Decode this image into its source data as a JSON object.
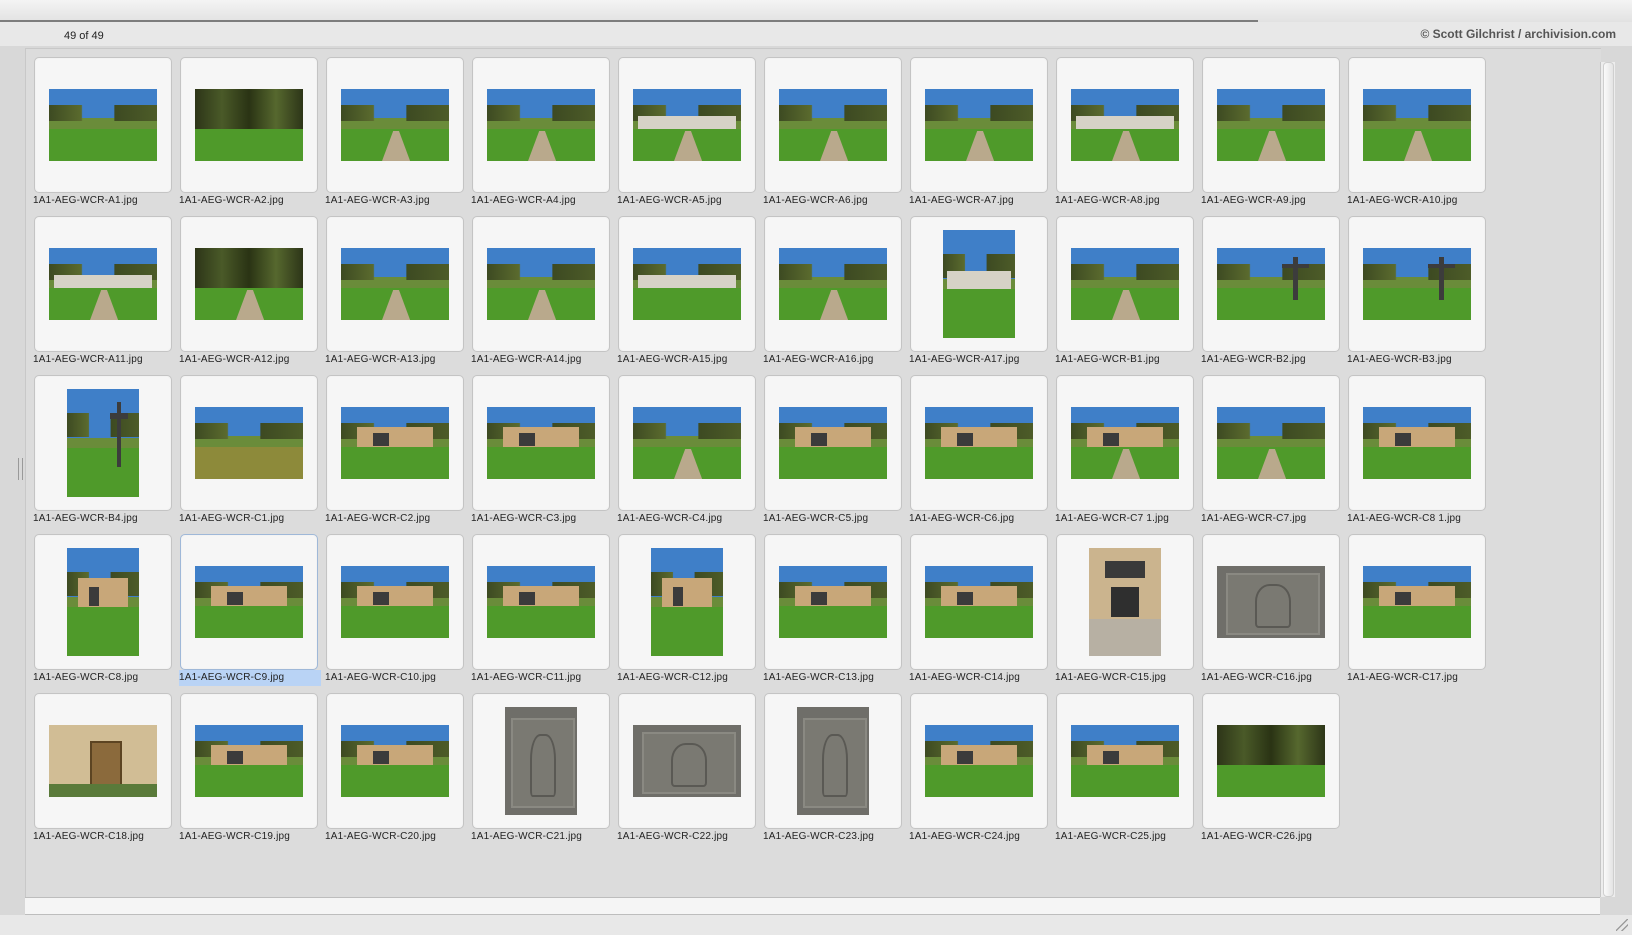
{
  "viewer": {
    "count_label": "49 of 49",
    "credit": "© Scott Gilchrist / archivision.com",
    "selected_index": 31
  },
  "colors": {
    "background": "#d8d8d8",
    "card": "#f6f6f6",
    "selection": "#b9d3f5"
  },
  "thumbnails": [
    {
      "filename": "1A1-AEG-WCR-A1.jpg",
      "orientation": "landscape",
      "kind": "lawn"
    },
    {
      "filename": "1A1-AEG-WCR-A2.jpg",
      "orientation": "landscape",
      "kind": "forest"
    },
    {
      "filename": "1A1-AEG-WCR-A3.jpg",
      "orientation": "landscape",
      "kind": "path"
    },
    {
      "filename": "1A1-AEG-WCR-A4.jpg",
      "orientation": "landscape",
      "kind": "path"
    },
    {
      "filename": "1A1-AEG-WCR-A5.jpg",
      "orientation": "landscape",
      "kind": "gate"
    },
    {
      "filename": "1A1-AEG-WCR-A6.jpg",
      "orientation": "landscape",
      "kind": "path"
    },
    {
      "filename": "1A1-AEG-WCR-A7.jpg",
      "orientation": "landscape",
      "kind": "path"
    },
    {
      "filename": "1A1-AEG-WCR-A8.jpg",
      "orientation": "landscape",
      "kind": "gate"
    },
    {
      "filename": "1A1-AEG-WCR-A9.jpg",
      "orientation": "landscape",
      "kind": "steps"
    },
    {
      "filename": "1A1-AEG-WCR-A10.jpg",
      "orientation": "landscape",
      "kind": "steps"
    },
    {
      "filename": "1A1-AEG-WCR-A11.jpg",
      "orientation": "landscape",
      "kind": "gate"
    },
    {
      "filename": "1A1-AEG-WCR-A12.jpg",
      "orientation": "landscape",
      "kind": "avenue"
    },
    {
      "filename": "1A1-AEG-WCR-A13.jpg",
      "orientation": "landscape",
      "kind": "path"
    },
    {
      "filename": "1A1-AEG-WCR-A14.jpg",
      "orientation": "landscape",
      "kind": "path"
    },
    {
      "filename": "1A1-AEG-WCR-A15.jpg",
      "orientation": "landscape",
      "kind": "wall"
    },
    {
      "filename": "1A1-AEG-WCR-A16.jpg",
      "orientation": "landscape",
      "kind": "path"
    },
    {
      "filename": "1A1-AEG-WCR-A17.jpg",
      "orientation": "portrait",
      "kind": "wallportrait"
    },
    {
      "filename": "1A1-AEG-WCR-B1.jpg",
      "orientation": "landscape",
      "kind": "path"
    },
    {
      "filename": "1A1-AEG-WCR-B2.jpg",
      "orientation": "landscape",
      "kind": "cross"
    },
    {
      "filename": "1A1-AEG-WCR-B3.jpg",
      "orientation": "landscape",
      "kind": "cross"
    },
    {
      "filename": "1A1-AEG-WCR-B4.jpg",
      "orientation": "portrait",
      "kind": "crossportrait"
    },
    {
      "filename": "1A1-AEG-WCR-C1.jpg",
      "orientation": "landscape",
      "kind": "field"
    },
    {
      "filename": "1A1-AEG-WCR-C2.jpg",
      "orientation": "landscape",
      "kind": "lawnbld"
    },
    {
      "filename": "1A1-AEG-WCR-C3.jpg",
      "orientation": "landscape",
      "kind": "lawnbld"
    },
    {
      "filename": "1A1-AEG-WCR-C4.jpg",
      "orientation": "landscape",
      "kind": "path"
    },
    {
      "filename": "1A1-AEG-WCR-C5.jpg",
      "orientation": "landscape",
      "kind": "building"
    },
    {
      "filename": "1A1-AEG-WCR-C6.jpg",
      "orientation": "landscape",
      "kind": "building"
    },
    {
      "filename": "1A1-AEG-WCR-C7 1.jpg",
      "orientation": "landscape",
      "kind": "portico"
    },
    {
      "filename": "1A1-AEG-WCR-C7.jpg",
      "orientation": "landscape",
      "kind": "path"
    },
    {
      "filename": "1A1-AEG-WCR-C8 1.jpg",
      "orientation": "landscape",
      "kind": "building"
    },
    {
      "filename": "1A1-AEG-WCR-C8.jpg",
      "orientation": "portrait",
      "kind": "towerportrait"
    },
    {
      "filename": "1A1-AEG-WCR-C9.jpg",
      "orientation": "landscape",
      "kind": "building"
    },
    {
      "filename": "1A1-AEG-WCR-C10.jpg",
      "orientation": "landscape",
      "kind": "building"
    },
    {
      "filename": "1A1-AEG-WCR-C11.jpg",
      "orientation": "landscape",
      "kind": "facade"
    },
    {
      "filename": "1A1-AEG-WCR-C12.jpg",
      "orientation": "portrait",
      "kind": "bldportrait"
    },
    {
      "filename": "1A1-AEG-WCR-C13.jpg",
      "orientation": "landscape",
      "kind": "facade"
    },
    {
      "filename": "1A1-AEG-WCR-C14.jpg",
      "orientation": "landscape",
      "kind": "doorway"
    },
    {
      "filename": "1A1-AEG-WCR-C15.jpg",
      "orientation": "portrait",
      "kind": "doorportrait"
    },
    {
      "filename": "1A1-AEG-WCR-C16.jpg",
      "orientation": "landscape",
      "kind": "relief"
    },
    {
      "filename": "1A1-AEG-WCR-C17.jpg",
      "orientation": "landscape",
      "kind": "building"
    },
    {
      "filename": "1A1-AEG-WCR-C18.jpg",
      "orientation": "landscape",
      "kind": "door"
    },
    {
      "filename": "1A1-AEG-WCR-C19.jpg",
      "orientation": "landscape",
      "kind": "colonnade"
    },
    {
      "filename": "1A1-AEG-WCR-C20.jpg",
      "orientation": "landscape",
      "kind": "doorway"
    },
    {
      "filename": "1A1-AEG-WCR-C21.jpg",
      "orientation": "portrait",
      "kind": "reliefportrait"
    },
    {
      "filename": "1A1-AEG-WCR-C22.jpg",
      "orientation": "landscape",
      "kind": "relief"
    },
    {
      "filename": "1A1-AEG-WCR-C23.jpg",
      "orientation": "portrait",
      "kind": "reliefportrait"
    },
    {
      "filename": "1A1-AEG-WCR-C24.jpg",
      "orientation": "landscape",
      "kind": "lawnbld"
    },
    {
      "filename": "1A1-AEG-WCR-C25.jpg",
      "orientation": "landscape",
      "kind": "lawnbld"
    },
    {
      "filename": "1A1-AEG-WCR-C26.jpg",
      "orientation": "landscape",
      "kind": "trees"
    }
  ]
}
